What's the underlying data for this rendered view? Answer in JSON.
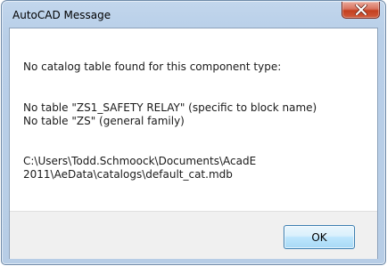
{
  "window": {
    "title": "AutoCAD Message"
  },
  "message": {
    "line1": "No catalog table found for this component type:",
    "line2": "No table \"ZS1_SAFETY RELAY\" (specific to block name)",
    "line3": "No table \"ZS\" (general family)",
    "line4": "C:\\Users\\Todd.Schmoock\\Documents\\AcadE",
    "line5": "2011\\AeData\\catalogs\\default_cat.mdb"
  },
  "buttons": {
    "ok_label": "OK"
  },
  "icons": {
    "close": "close-icon"
  },
  "colors": {
    "close_button": "#c4401f",
    "ok_button_border": "#3c7fb1"
  }
}
